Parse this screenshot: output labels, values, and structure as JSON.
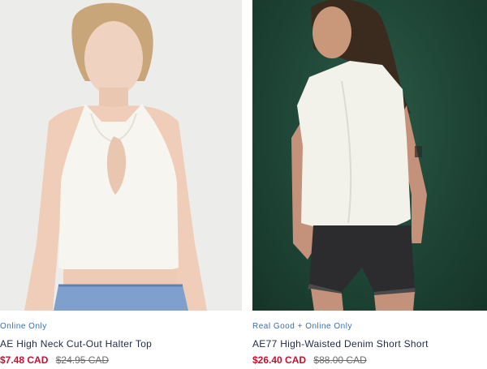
{
  "products": [
    {
      "badge": "Online Only",
      "title": "AE High Neck Cut-Out Halter Top",
      "sale_price": "$7.48 CAD",
      "original_price": "$24.95 CAD"
    },
    {
      "badge": "Real Good + Online Only",
      "title": "AE77 High-Waisted Denim Short Short",
      "sale_price": "$26.40 CAD",
      "original_price": "$88.00 CAD"
    }
  ],
  "colors": {
    "badge": "#3a6fa8",
    "sale": "#c8102e",
    "original": "#6b6b6b",
    "title": "#1f2a44",
    "right_background": "#1e4536"
  }
}
